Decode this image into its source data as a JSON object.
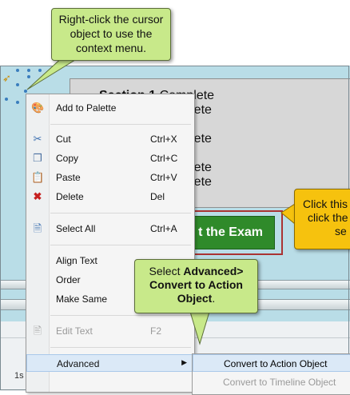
{
  "slide": {
    "sections": [
      {
        "name": "Section 1",
        "status": "Complete"
      },
      {
        "name": "",
        "status": "omplete"
      },
      {
        "name": "",
        "status": "te"
      },
      {
        "name": "",
        "status": "omplete"
      },
      {
        "name": "",
        "status": "te"
      },
      {
        "name": "",
        "status": "omplete"
      },
      {
        "name": "",
        "status": "omplete"
      }
    ],
    "exam_button_label": "t the Exam",
    "ruler_tick": "1s"
  },
  "context_menu": {
    "items": [
      {
        "label": "Add to Palette",
        "shortcut": "",
        "icon": "palette-icon"
      },
      {
        "label": "Cut",
        "shortcut": "Ctrl+X",
        "icon": "scissors-icon"
      },
      {
        "label": "Copy",
        "shortcut": "Ctrl+C",
        "icon": "copy-icon"
      },
      {
        "label": "Paste",
        "shortcut": "Ctrl+V",
        "icon": "paste-icon"
      },
      {
        "label": "Delete",
        "shortcut": "Del",
        "icon": "delete-x-icon"
      },
      {
        "label": "Select All",
        "shortcut": "Ctrl+A",
        "icon": "select-all-icon"
      },
      {
        "label": "Align Text",
        "shortcut": ""
      },
      {
        "label": "Order",
        "shortcut": ""
      },
      {
        "label": "Make Same",
        "shortcut": ""
      },
      {
        "label": "Edit Text",
        "shortcut": "F2",
        "icon": "edit-text-icon",
        "disabled": true
      },
      {
        "label": "Advanced",
        "shortcut": "",
        "has_submenu": true
      }
    ]
  },
  "submenu": {
    "items": [
      {
        "label": "Convert to Action Object"
      },
      {
        "label": "Convert to Timeline Object",
        "disabled": true
      }
    ]
  },
  "callouts": {
    "top": "Right-click the cursor object to use the context menu.",
    "middle_prefix": "Select ",
    "middle_bold": "Advanced> Convert to Action Object",
    "middle_suffix": ".",
    "right_line1": "Click this",
    "right_line2": "click the",
    "right_line3": "se"
  },
  "colors": {
    "callout_green": "#c8e98a",
    "callout_yellow": "#f6c20e",
    "exam_green": "#2f8a2a",
    "stage_blue": "#b9dde7"
  }
}
